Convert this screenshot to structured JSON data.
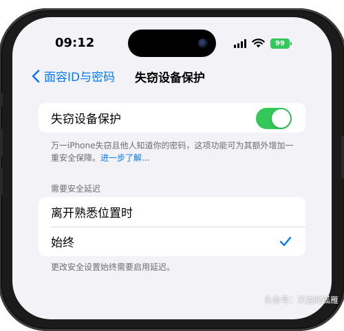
{
  "status_bar": {
    "time": "09:12",
    "battery": "99"
  },
  "nav": {
    "back_label": "面容ID与密码",
    "title": "失窃设备保护"
  },
  "protection_toggle": {
    "label": "失窃设备保护",
    "enabled": true
  },
  "protection_footer": {
    "text": "万一iPhone失窃且他人知道你的密码，这项功能可为其额外增加一重安全保障。",
    "link": "进一步了解..."
  },
  "delay_section": {
    "header": "需要安全延迟",
    "options": [
      {
        "label": "离开熟悉位置时",
        "selected": false
      },
      {
        "label": "始终",
        "selected": true
      }
    ],
    "footer": "更改安全设置始终需要启用延迟。"
  },
  "watermark": "头条号：天边的孤雁",
  "colors": {
    "accent": "#007aff",
    "toggle_on": "#34c759",
    "background": "#f2f2f7"
  }
}
